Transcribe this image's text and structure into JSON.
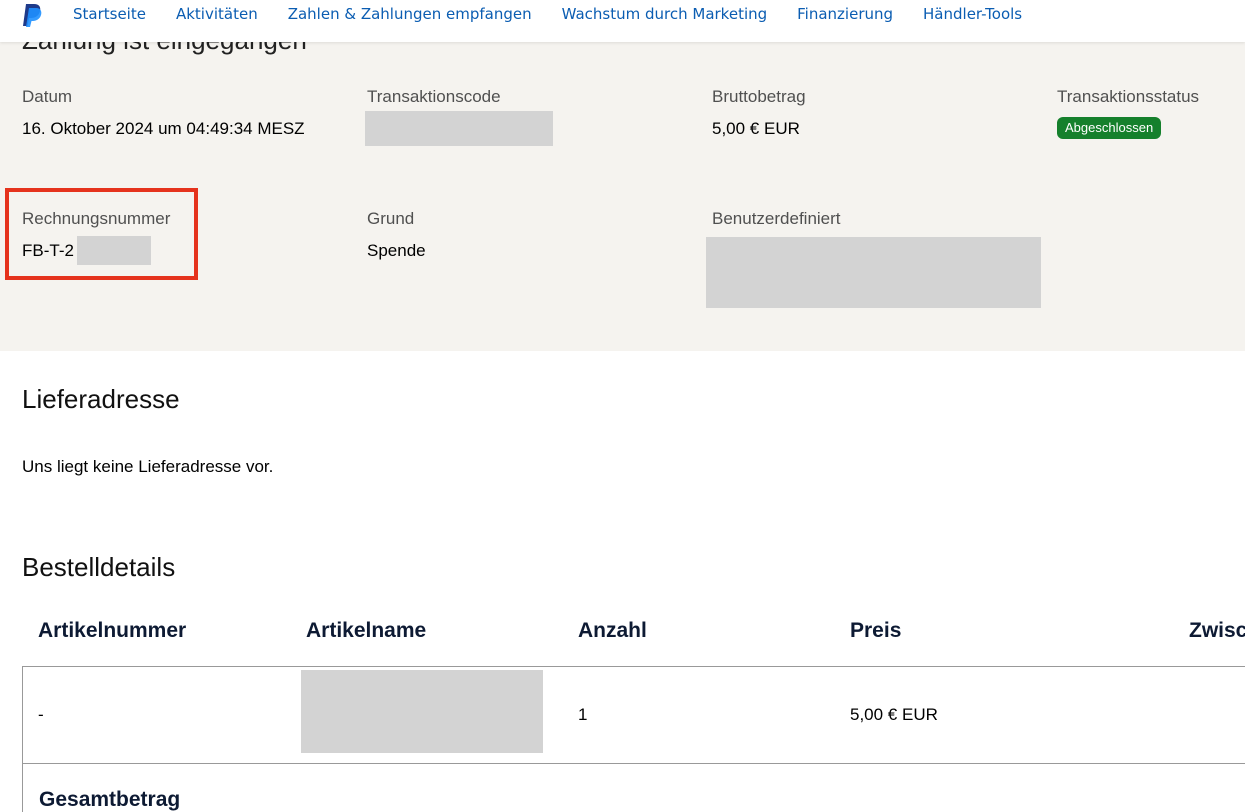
{
  "nav": {
    "logo_icon": "paypal-logo",
    "items": [
      {
        "label": "Startseite"
      },
      {
        "label": "Aktivitäten"
      },
      {
        "label": "Zahlen & Zahlungen empfangen"
      },
      {
        "label": "Wachstum durch Marketing"
      },
      {
        "label": "Finanzierung"
      },
      {
        "label": "Händler-Tools"
      }
    ]
  },
  "summary": {
    "title": "Zahlung ist eingegangen",
    "date": {
      "label": "Datum",
      "value": "16. Oktober 2024 um 04:49:34 MESZ"
    },
    "transaction_code": {
      "label": "Transaktionscode"
    },
    "gross_amount": {
      "label": "Bruttobetrag",
      "value": "5,00 € EUR"
    },
    "status": {
      "label": "Transaktionsstatus",
      "value": "Abgeschlossen",
      "color": "#15802c"
    },
    "invoice": {
      "label": "Rechnungsnummer",
      "value": "FB-T-2"
    },
    "reason": {
      "label": "Grund",
      "value": "Spende"
    },
    "custom": {
      "label": "Benutzerdefiniert"
    },
    "highlight_color": "#e5321c"
  },
  "delivery": {
    "title": "Lieferadresse",
    "text": "Uns liegt keine Lieferadresse vor."
  },
  "order": {
    "title": "Bestelldetails",
    "columns": [
      "Artikelnummer",
      "Artikelname",
      "Anzahl",
      "Preis",
      "Zwisc"
    ],
    "rows": [
      {
        "item_number": "-",
        "quantity": "1",
        "price": "5,00 € EUR"
      }
    ],
    "total_label": "Gesamtbetrag"
  }
}
